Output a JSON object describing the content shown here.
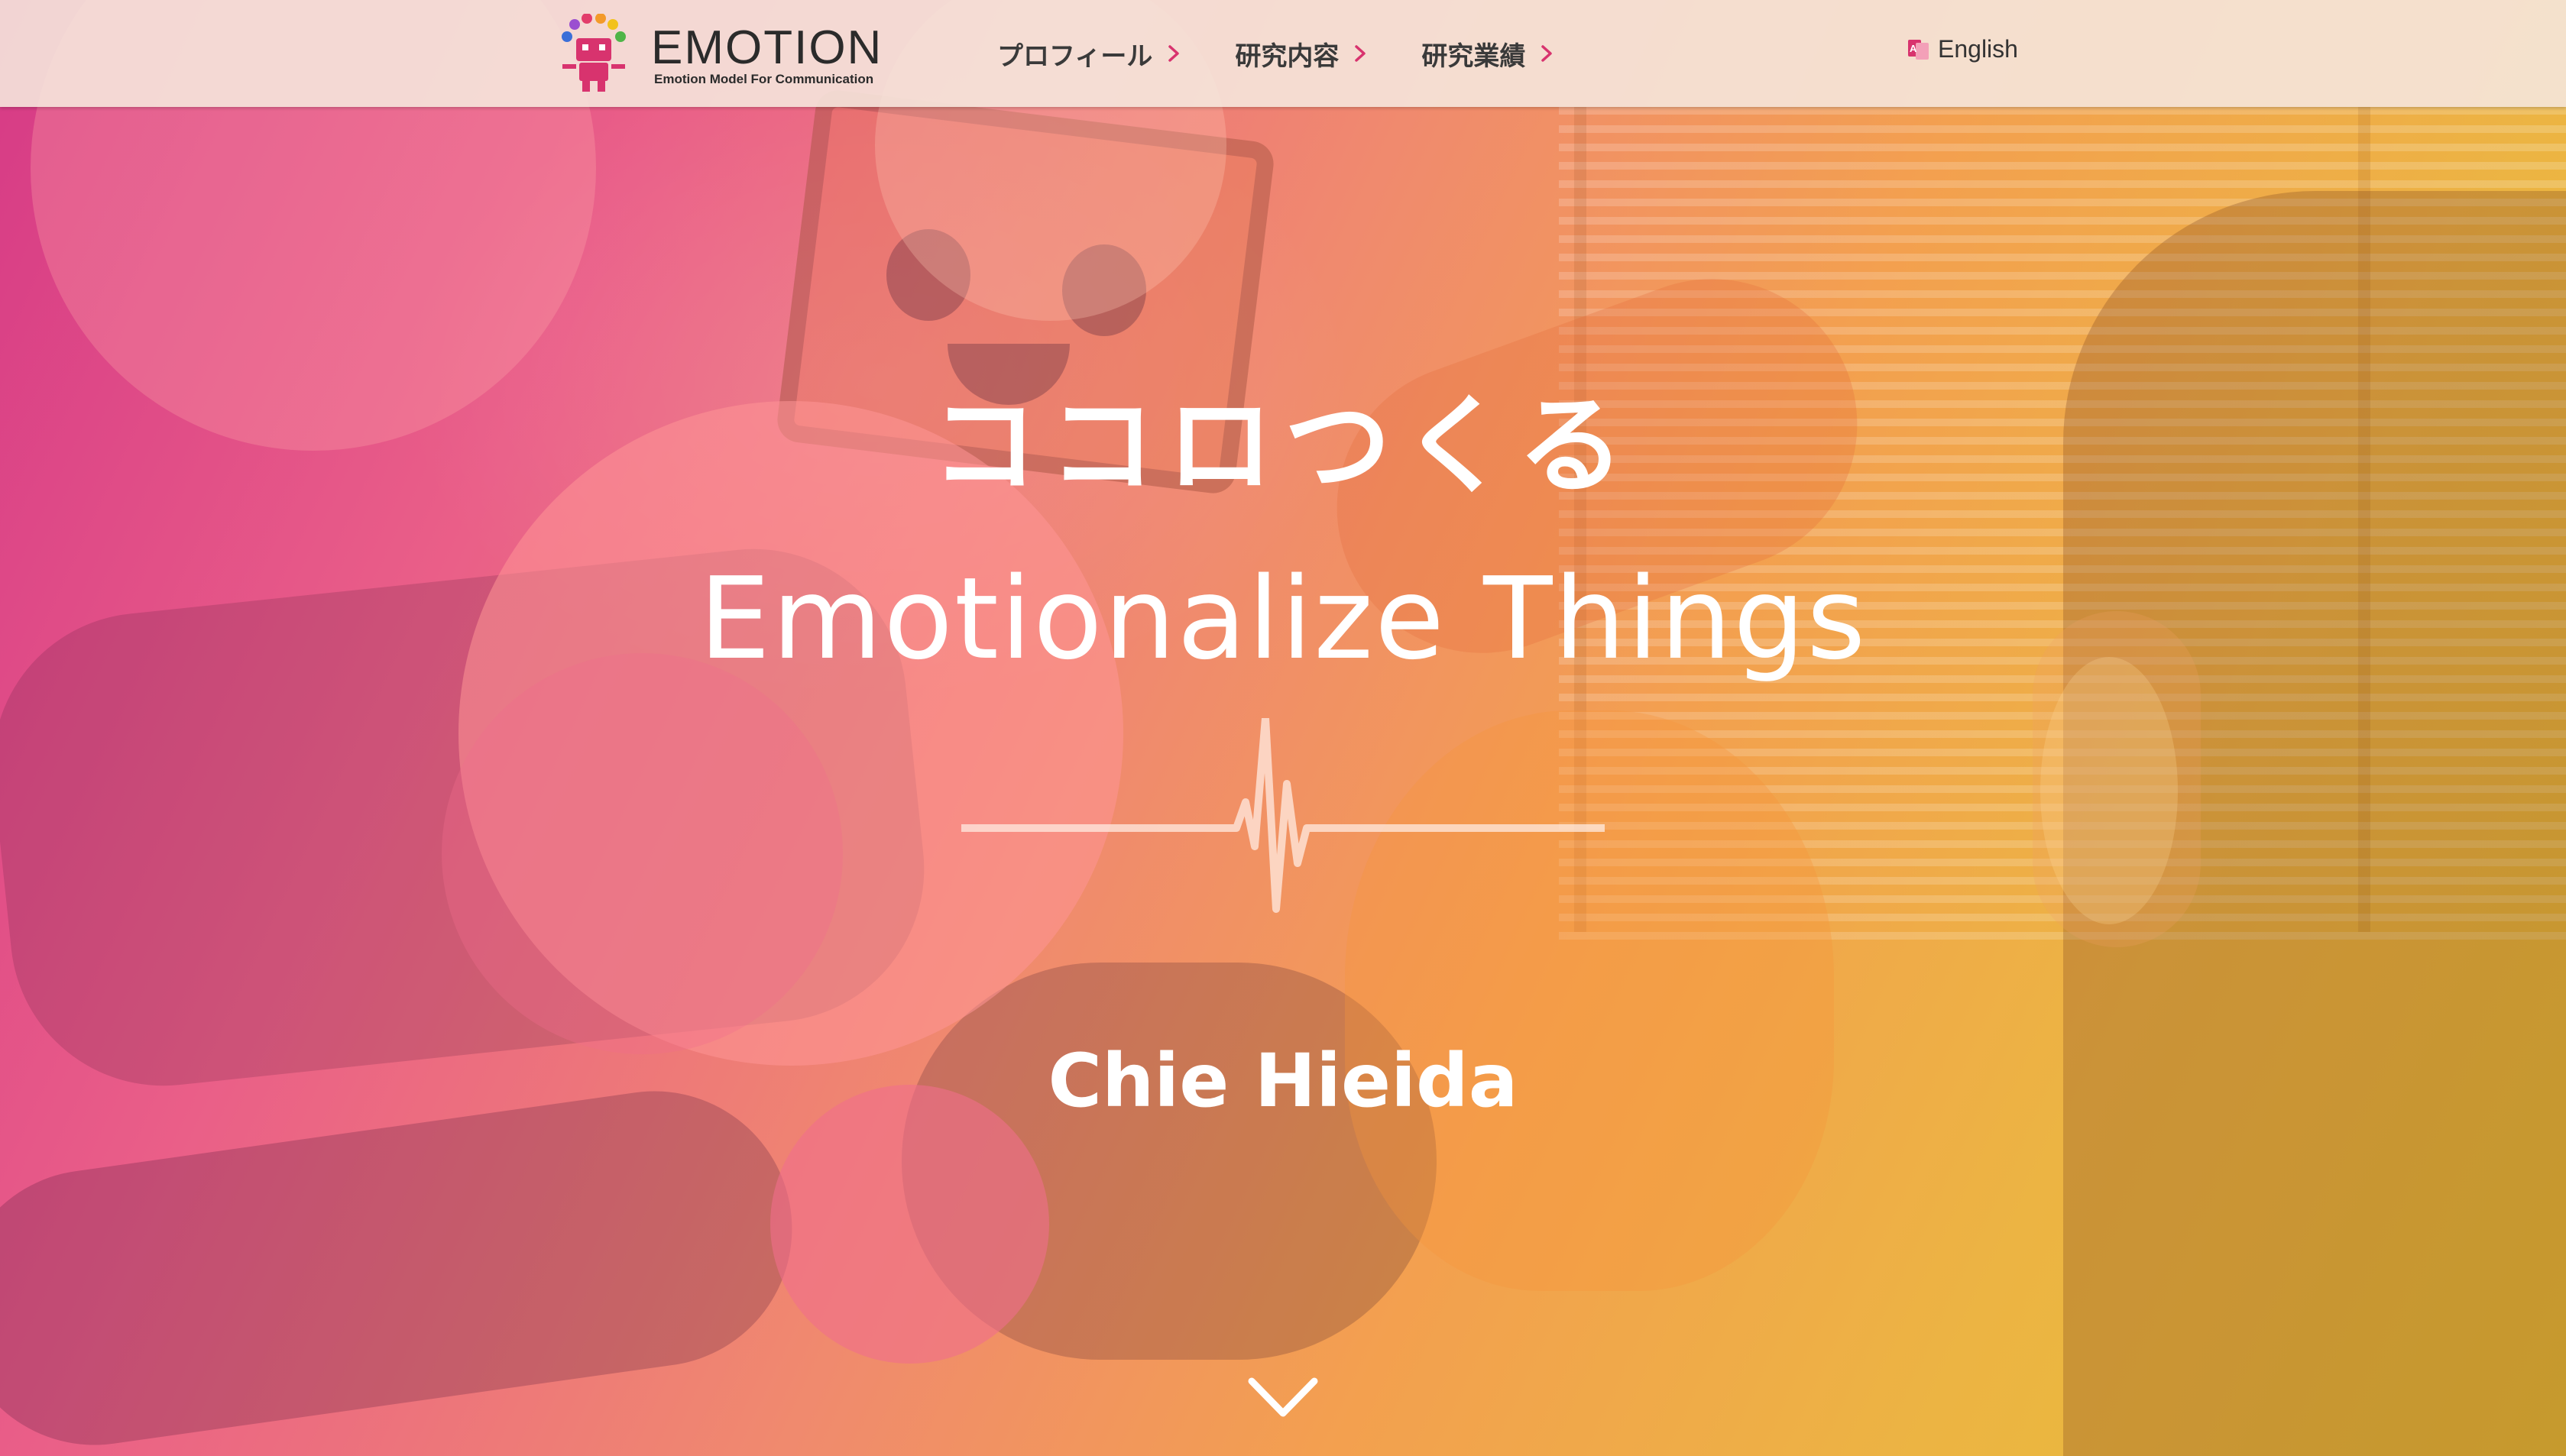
{
  "header": {
    "logo": {
      "title": "EMOTION",
      "subtitle": "Emotion Model For Communication"
    },
    "nav": [
      {
        "label": "プロフィール"
      },
      {
        "label": "研究内容"
      },
      {
        "label": "研究業績"
      }
    ],
    "language": {
      "label": "English",
      "icon": "language-switch-icon"
    }
  },
  "hero": {
    "title_jp": "ココロつくる",
    "title_en": "Emotionalize Things",
    "name": "Chie Hieida",
    "scroll_icon": "chevron-down-icon"
  },
  "colors": {
    "accent": "#d8336e",
    "gradient_start": "#d63a86",
    "gradient_end": "#e5be34",
    "text_light": "#ffffff",
    "nav_text": "#3a3a3a"
  }
}
